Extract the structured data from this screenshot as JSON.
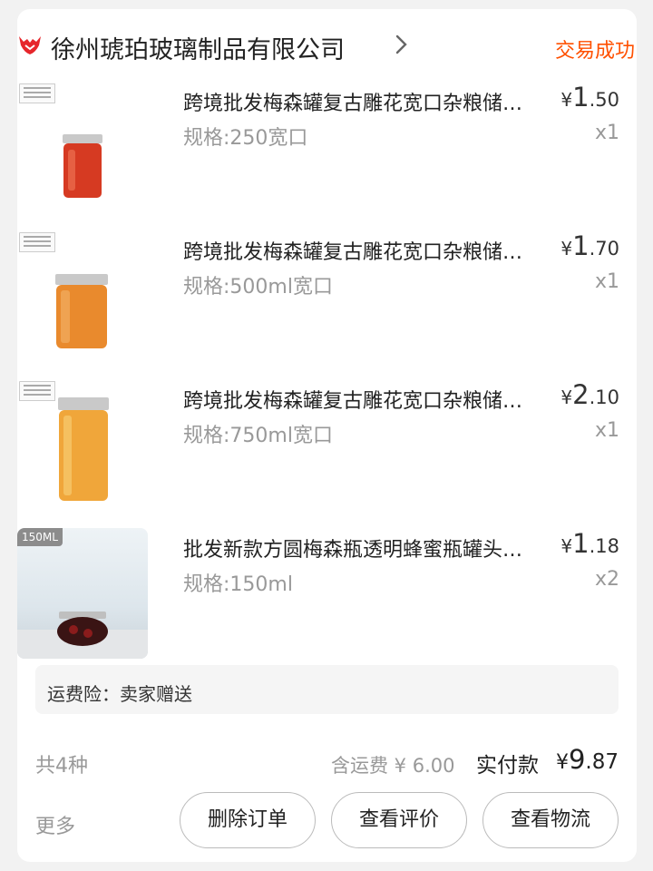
{
  "shop": {
    "name": "徐州琥珀玻璃制品有限公司",
    "icon": "shop-logo-icon",
    "status": "交易成功"
  },
  "items": [
    {
      "title": "跨境批发梅森罐复古雕花宽口杂粮储物罐密封蜂蜜玻璃瓶",
      "spec": "规格:250宽口",
      "currency": "¥",
      "price_int": "1",
      "price_dec": ".50",
      "qty": "x1",
      "image": "mason-jar-red"
    },
    {
      "title": "跨境批发梅森罐复古雕花宽口杂粮储物罐密封蜂蜜玻璃瓶",
      "spec": "规格:500ml宽口",
      "currency": "¥",
      "price_int": "1",
      "price_dec": ".70",
      "qty": "x1",
      "image": "mason-jar-orange"
    },
    {
      "title": "跨境批发梅森罐复古雕花宽口杂粮储物罐密封蜂蜜玻璃瓶",
      "spec": "规格:750ml宽口",
      "currency": "¥",
      "price_int": "2",
      "price_dec": ".10",
      "qty": "x1",
      "image": "mason-jar-pasta"
    },
    {
      "title": "批发新款方圆梅森瓶透明蜂蜜瓶罐头瓶果酱瓶",
      "spec": "规格:150ml",
      "currency": "¥",
      "price_int": "1",
      "price_dec": ".18",
      "qty": "x2",
      "image": "mason-jar-lifestyle",
      "badge": "150ML"
    }
  ],
  "insurance": {
    "label": "运费险：卖家赠送"
  },
  "summary": {
    "kind_count": "共4种",
    "shipping": "含运费 ¥ 6.00",
    "paid_label": "实付款",
    "currency": "¥",
    "paid_int": "9",
    "paid_dec": ".87"
  },
  "actions": {
    "more": "更多",
    "delete": "删除订单",
    "review": "查看评价",
    "logistics": "查看物流"
  },
  "colors": {
    "accent": "#ff5000",
    "muted": "#999999"
  }
}
